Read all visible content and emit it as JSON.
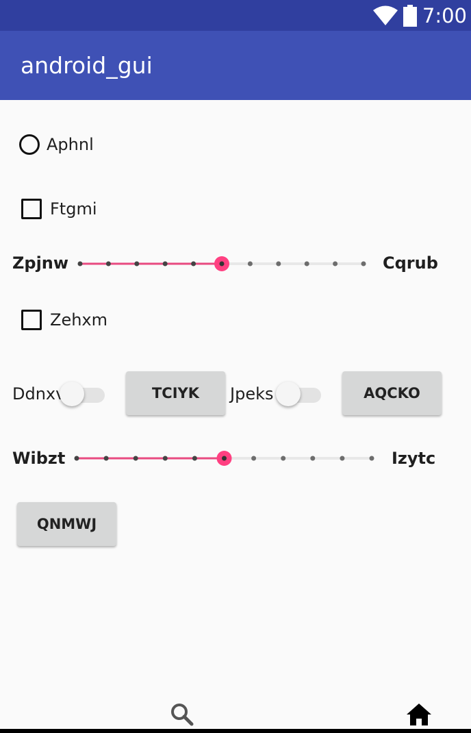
{
  "status_bar": {
    "time": "7:00",
    "icons": [
      "wifi-icon",
      "battery-icon"
    ]
  },
  "app_bar": {
    "title": "android_gui"
  },
  "radio_button": {
    "label": "Aphnl",
    "checked": false
  },
  "checkbox_1": {
    "label": "Ftgmi",
    "checked": false
  },
  "slider_1": {
    "left_label": "Zpjnw",
    "right_label": "Cqrub",
    "steps": 10,
    "value": 5
  },
  "checkbox_2": {
    "label": "Zehxm",
    "checked": false
  },
  "switch_1": {
    "label": "Ddnxv",
    "on": false
  },
  "button_1": {
    "label": "TCIYK"
  },
  "switch_2": {
    "label": "Jpeks",
    "on": false
  },
  "button_2": {
    "label": "AQCKO"
  },
  "slider_2": {
    "left_label": "Wibzt",
    "right_label": "Izytc",
    "steps": 10,
    "value": 5
  },
  "button_3": {
    "label": "QNMWJ"
  },
  "nav_bar": {
    "icons": [
      "search-icon",
      "home-icon"
    ]
  },
  "colors": {
    "status_bar": "#303f9f",
    "app_bar": "#3f51b5",
    "accent": "#ff4081",
    "slider_active_track": "#e84a80"
  }
}
